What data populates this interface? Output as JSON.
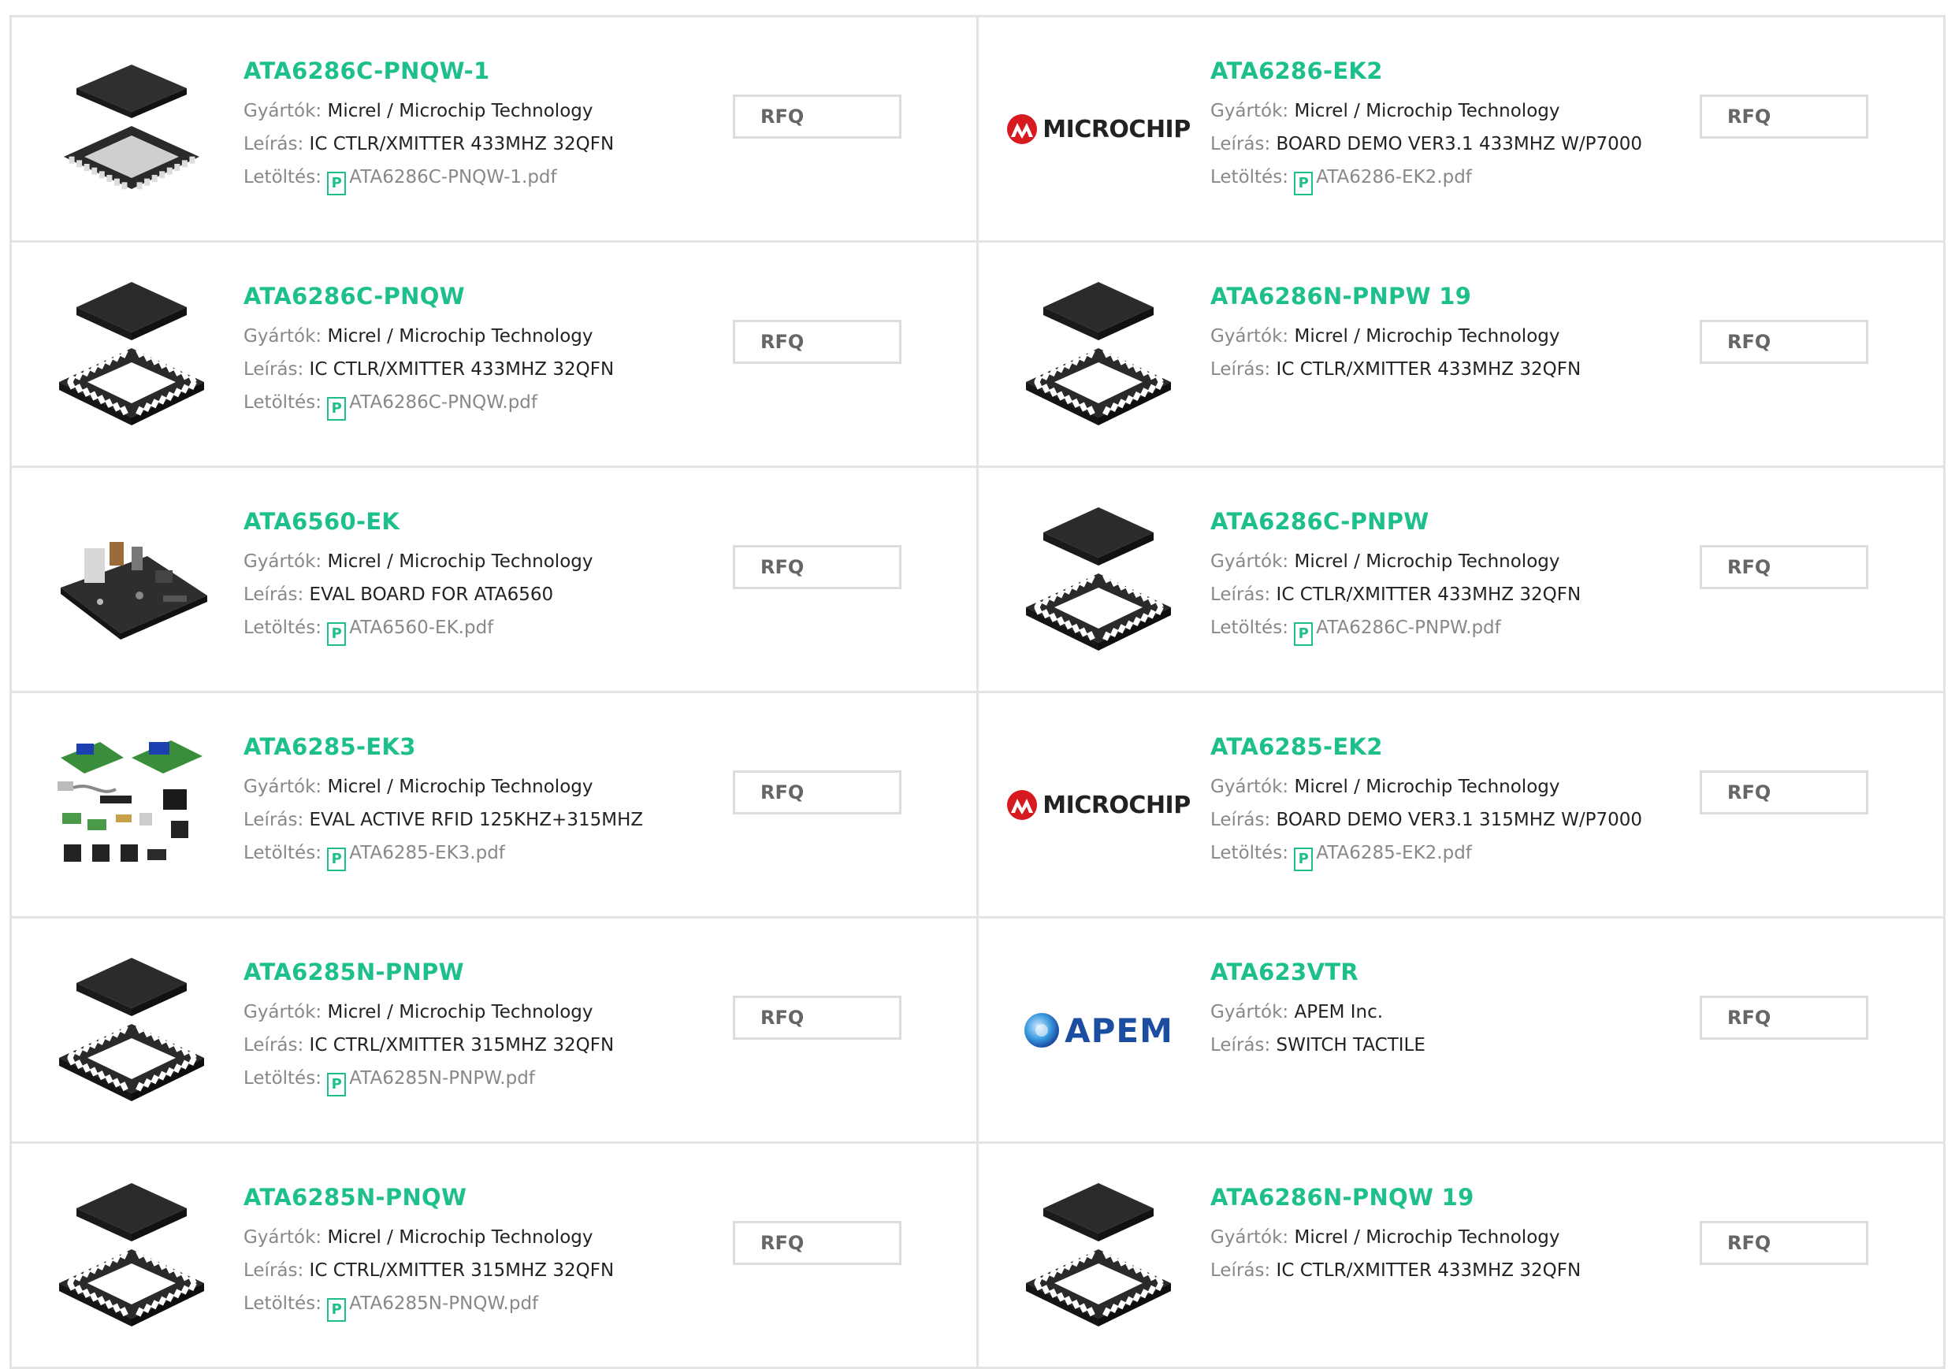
{
  "labels": {
    "manufacturer": "Gyártók:",
    "description": "Leírás:",
    "download": "Letöltés:",
    "rfq": "RFQ"
  },
  "products": [
    {
      "part": "ATA6286C-PNQW-1",
      "manufacturer": "Micrel / Microchip Technology",
      "description": "IC CTLR/XMITTER 433MHZ 32QFN",
      "pdf": "ATA6286C-PNQW-1.pdf",
      "image": "qfn-chip-icon"
    },
    {
      "part": "ATA6286-EK2",
      "manufacturer": "Micrel / Microchip Technology",
      "description": "BOARD DEMO VER3.1 433MHZ W/P7000",
      "pdf": "ATA6286-EK2.pdf",
      "image": "microchip-logo",
      "logo_text": "MICROCHIP"
    },
    {
      "part": "ATA6286C-PNQW",
      "manufacturer": "Micrel / Microchip Technology",
      "description": "IC CTLR/XMITTER 433MHZ 32QFN",
      "pdf": "ATA6286C-PNQW.pdf",
      "image": "qfn-chip-icon"
    },
    {
      "part": "ATA6286N-PNPW 19",
      "manufacturer": "Micrel / Microchip Technology",
      "description": "IC CTLR/XMITTER 433MHZ 32QFN",
      "pdf": null,
      "image": "qfn-chip-icon"
    },
    {
      "part": "ATA6560-EK",
      "manufacturer": "Micrel / Microchip Technology",
      "description": "EVAL BOARD FOR ATA6560",
      "pdf": "ATA6560-EK.pdf",
      "image": "eval-board-icon"
    },
    {
      "part": "ATA6286C-PNPW",
      "manufacturer": "Micrel / Microchip Technology",
      "description": "IC CTLR/XMITTER 433MHZ 32QFN",
      "pdf": "ATA6286C-PNPW.pdf",
      "image": "qfn-chip-icon"
    },
    {
      "part": "ATA6285-EK3",
      "manufacturer": "Micrel / Microchip Technology",
      "description": "EVAL ACTIVE RFID 125KHZ+315MHZ",
      "pdf": "ATA6285-EK3.pdf",
      "image": "rfid-kit-icon"
    },
    {
      "part": "ATA6285-EK2",
      "manufacturer": "Micrel / Microchip Technology",
      "description": "BOARD DEMO VER3.1 315MHZ W/P7000",
      "pdf": "ATA6285-EK2.pdf",
      "image": "microchip-logo",
      "logo_text": "MICROCHIP"
    },
    {
      "part": "ATA6285N-PNPW",
      "manufacturer": "Micrel / Microchip Technology",
      "description": "IC CTRL/XMITTER 315MHZ 32QFN",
      "pdf": "ATA6285N-PNPW.pdf",
      "image": "qfn-chip-icon"
    },
    {
      "part": "ATA623VTR",
      "manufacturer": "APEM Inc.",
      "description": "SWITCH TACTILE",
      "pdf": null,
      "image": "apem-logo",
      "logo_text": "APEM"
    },
    {
      "part": "ATA6285N-PNQW",
      "manufacturer": "Micrel / Microchip Technology",
      "description": "IC CTRL/XMITTER 315MHZ 32QFN",
      "pdf": "ATA6285N-PNQW.pdf",
      "image": "qfn-chip-icon"
    },
    {
      "part": "ATA6286N-PNQW 19",
      "manufacturer": "Micrel / Microchip Technology",
      "description": "IC CTLR/XMITTER 433MHZ 32QFN",
      "pdf": null,
      "image": "qfn-chip-icon"
    }
  ],
  "colors": {
    "part_link": "#1dbf8c",
    "label": "#888888",
    "border": "#e3e3e3",
    "microchip_red": "#d71920",
    "apem_blue": "#1b4da1"
  }
}
